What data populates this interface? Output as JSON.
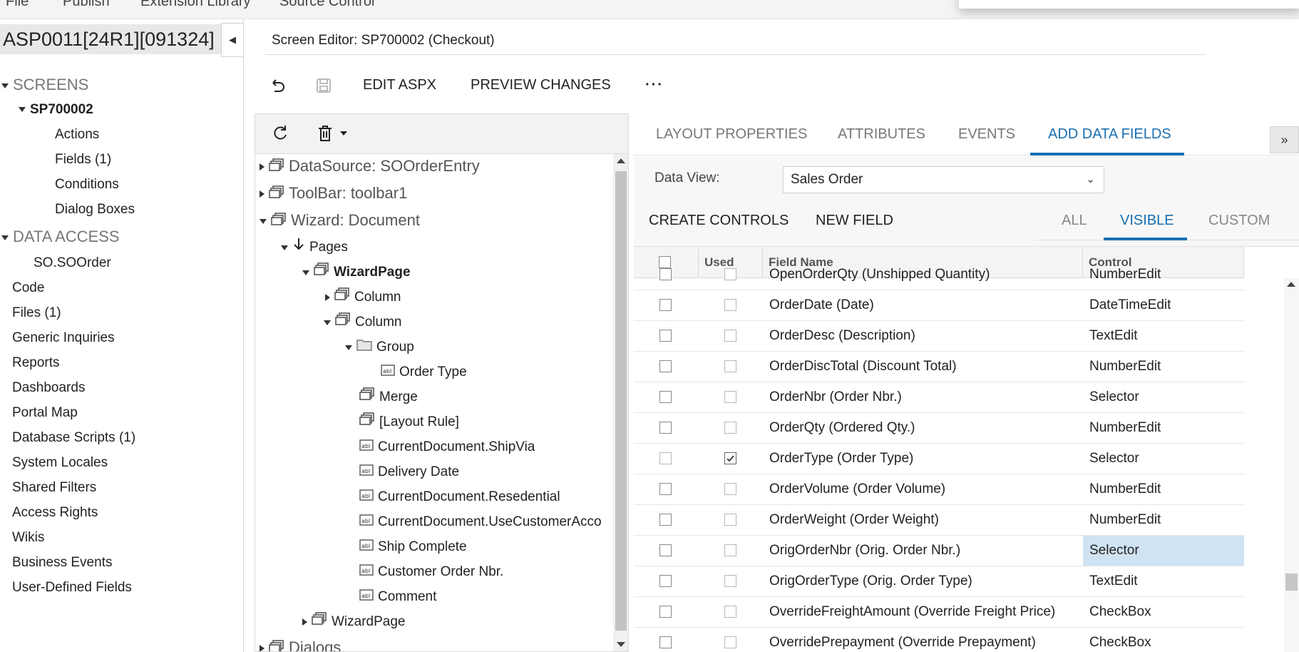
{
  "menu": [
    "File",
    "Publish",
    "Extension Library",
    "Source Control"
  ],
  "project": {
    "name": "ASP0011[24R1][091324]"
  },
  "nav": {
    "screens_label": "SCREENS",
    "screen_id": "SP700002",
    "screen_items": [
      "Actions",
      "Fields (1)",
      "Conditions",
      "Dialog Boxes"
    ],
    "data_access_label": "DATA ACCESS",
    "data_access_items": [
      "SO.SOOrder"
    ],
    "items": [
      "Code",
      "Files (1)",
      "Generic Inquiries",
      "Reports",
      "Dashboards",
      "Portal Map",
      "Database Scripts (1)",
      "System Locales",
      "Shared Filters",
      "Access Rights",
      "Wikis",
      "Business Events",
      "User-Defined Fields"
    ]
  },
  "editor": {
    "title": "Screen Editor: SP700002 (Checkout)",
    "toolbar": {
      "undo_icon": "undo-icon",
      "save_icon": "save-icon",
      "edit_aspx": "EDIT ASPX",
      "preview_changes": "PREVIEW CHANGES",
      "more": "···"
    }
  },
  "tree": [
    {
      "label": "DataSource: SOOrderEntry",
      "icon": "container-icon"
    },
    {
      "label": "ToolBar: toolbar1",
      "icon": "container-icon"
    },
    {
      "label": "Wizard: Document",
      "icon": "container-icon"
    },
    {
      "label": "Pages",
      "icon": "arrow-down-icon"
    },
    {
      "label": "WizardPage",
      "icon": "container-icon"
    },
    {
      "label": "Column",
      "icon": "container-icon"
    },
    {
      "label": "Column",
      "icon": "container-icon"
    },
    {
      "label": "Group",
      "icon": "folder-icon"
    },
    {
      "label": "Order Type",
      "icon": "field-icon"
    },
    {
      "label": "Merge",
      "icon": "container-icon"
    },
    {
      "label": "[Layout Rule]",
      "icon": "container-icon"
    },
    {
      "label": "CurrentDocument.ShipVia",
      "icon": "field-icon"
    },
    {
      "label": "Delivery Date",
      "icon": "field-icon"
    },
    {
      "label": "CurrentDocument.Resedential",
      "icon": "field-icon"
    },
    {
      "label": "CurrentDocument.UseCustomerAcco",
      "icon": "field-icon"
    },
    {
      "label": "Ship Complete",
      "icon": "field-icon"
    },
    {
      "label": "Customer Order Nbr.",
      "icon": "field-icon"
    },
    {
      "label": "Comment",
      "icon": "field-icon"
    },
    {
      "label": "WizardPage",
      "icon": "container-icon"
    },
    {
      "label": "Dialogs",
      "icon": "container-icon"
    }
  ],
  "tabs": [
    "LAYOUT PROPERTIES",
    "ATTRIBUTES",
    "EVENTS",
    "ADD DATA FIELDS"
  ],
  "add_fields": {
    "data_view_label": "Data View:",
    "data_view_value": "Sales Order",
    "create_controls": "CREATE CONTROLS",
    "new_field": "NEW FIELD",
    "filters": [
      "ALL",
      "VISIBLE",
      "CUSTOM"
    ],
    "columns": [
      "Used",
      "Field Name",
      "Control"
    ],
    "rows": [
      {
        "field": "OpenOrderQty (Unshipped Quantity)",
        "control": "NumberEdit",
        "used": false,
        "disabled": false
      },
      {
        "field": "OrderDate (Date)",
        "control": "DateTimeEdit",
        "used": false,
        "disabled": false
      },
      {
        "field": "OrderDesc (Description)",
        "control": "TextEdit",
        "used": false,
        "disabled": false
      },
      {
        "field": "OrderDiscTotal (Discount Total)",
        "control": "NumberEdit",
        "used": false,
        "disabled": false
      },
      {
        "field": "OrderNbr (Order Nbr.)",
        "control": "Selector",
        "used": false,
        "disabled": false
      },
      {
        "field": "OrderQty (Ordered Qty.)",
        "control": "NumberEdit",
        "used": false,
        "disabled": false
      },
      {
        "field": "OrderType (Order Type)",
        "control": "Selector",
        "used": true,
        "disabled": true
      },
      {
        "field": "OrderVolume (Order Volume)",
        "control": "NumberEdit",
        "used": false,
        "disabled": false
      },
      {
        "field": "OrderWeight (Order Weight)",
        "control": "NumberEdit",
        "used": false,
        "disabled": false
      },
      {
        "field": "OrigOrderNbr (Orig. Order Nbr.)",
        "control": "Selector",
        "used": false,
        "disabled": false,
        "selected": true
      },
      {
        "field": "OrigOrderType (Orig. Order Type)",
        "control": "TextEdit",
        "used": false,
        "disabled": false
      },
      {
        "field": "OverrideFreightAmount (Override Freight Price)",
        "control": "CheckBox",
        "used": false,
        "disabled": false
      },
      {
        "field": "OverridePrepayment (Override Prepayment)",
        "control": "CheckBox",
        "used": false,
        "disabled": false
      }
    ]
  },
  "colors": {
    "accent": "#1a6fb0",
    "selected_cell": "#cfe3f3",
    "panel_bg": "#f7f7f7"
  }
}
